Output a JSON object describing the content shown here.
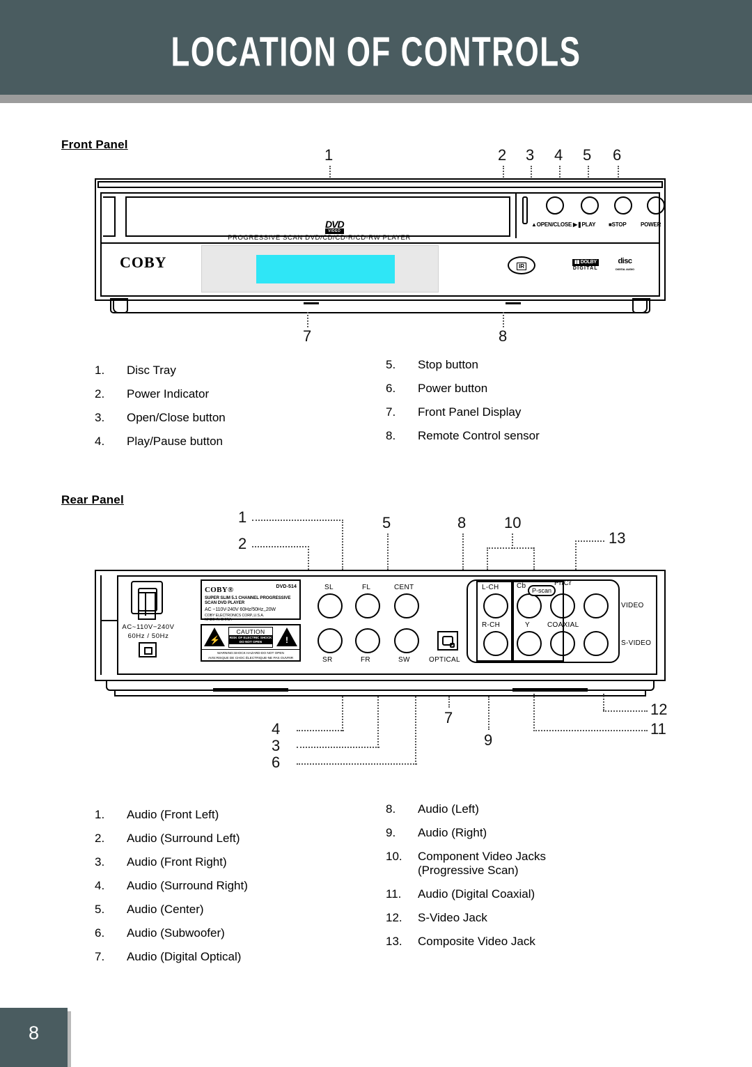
{
  "header": {
    "title": "LOCATION OF CONTROLS",
    "bar_color": "#4a5c60",
    "rule_color": "#9c9c9c"
  },
  "front_panel": {
    "heading": "Front Panel",
    "callouts_top": [
      "1",
      "2",
      "3",
      "4",
      "5",
      "6"
    ],
    "callouts_bottom": [
      "7",
      "8"
    ],
    "device": {
      "brand": "COBY",
      "dvd_logo": "DVD",
      "dvd_logo_sub": "VIDEO",
      "tray_text": "PROGRESSIVE SCAN DVD/CD/CD-R/CD-RW PLAYER",
      "buttons": [
        {
          "label": "▲OPEN/CLOSE"
        },
        {
          "label": "▶❚PLAY"
        },
        {
          "label": "■STOP"
        },
        {
          "label": "POWER"
        }
      ],
      "ir_label": "IR",
      "dolby_top": "▮▮ DOLBY",
      "dolby_bottom": "DIGITAL",
      "cd_logo_top": "disc",
      "cd_logo_bottom": "DIGITAL AUDIO",
      "display_color": "#2fe6f6"
    },
    "list_left": [
      {
        "num": "1.",
        "text": "Disc Tray"
      },
      {
        "num": "2.",
        "text": "Power Indicator"
      },
      {
        "num": "3.",
        "text": "Open/Close button"
      },
      {
        "num": "4.",
        "text": "Play/Pause button"
      }
    ],
    "list_right": [
      {
        "num": "5.",
        "text": "Stop button"
      },
      {
        "num": "6.",
        "text": "Power button"
      },
      {
        "num": "7.",
        "text": "Front Panel Display"
      },
      {
        "num": "8.",
        "text": "Remote Control sensor"
      }
    ]
  },
  "rear_panel": {
    "heading": "Rear Panel",
    "callouts_top": [
      "1",
      "2",
      "5",
      "8",
      "10",
      "13"
    ],
    "callouts_bottom": [
      "4",
      "3",
      "6",
      "7",
      "9",
      "12",
      "11"
    ],
    "device": {
      "ac_text_line1": "AC~110V−240V",
      "ac_text_line2": "60Hz / 50Hz",
      "label": {
        "brand": "COBY®",
        "model": "DVD-514",
        "line1": "SUPER SLIM 5.1 CHANNEL PROGRESSIVE",
        "line2": "SCAN DVD PLAYER",
        "line3": "AC ~110V-240V 60Hz/50Hz,,20W",
        "line4": "COBY ELECTRONICS CORP.,U.S.A.",
        "line5": "MADE IN CHINA"
      },
      "caution": {
        "title": "CAUTION",
        "sub1": "RISK OF ELECTRIC SHOCK",
        "sub2": "DO NOT OPEN",
        "warn1": "WARNING:SHOCK HAZARD-DO NOT OPEN",
        "warn2": "AVIS:RISQUE DE CHOC ÉLECTRIQUE-NE PAS OUVRIR"
      },
      "jack_labels": {
        "sl": "SL",
        "fl": "FL",
        "cent": "CENT",
        "sr": "SR",
        "fr": "FR",
        "sw": "SW",
        "optical": "OPTICAL",
        "l_ch": "L-CH",
        "r_ch": "R-CH",
        "cb": "Cb",
        "y": "Y",
        "pr_cr": "Pr/Cr",
        "p_scan": "P-scan",
        "coaxial": "COAXIAL",
        "video": "VIDEO",
        "s_video": "S-VIDEO"
      }
    },
    "list_left": [
      {
        "num": "1.",
        "text": "Audio (Front Left)"
      },
      {
        "num": "2.",
        "text": "Audio (Surround Left)"
      },
      {
        "num": "3.",
        "text": "Audio (Front Right)"
      },
      {
        "num": "4.",
        "text": "Audio (Surround Right)"
      },
      {
        "num": "5.",
        "text": "Audio (Center)"
      },
      {
        "num": "6.",
        "text": "Audio (Subwoofer)"
      },
      {
        "num": "7.",
        "text": "Audio (Digital Optical)"
      }
    ],
    "list_right": [
      {
        "num": "8.",
        "text": "Audio (Left)",
        "cont": ""
      },
      {
        "num": "9.",
        "text": "Audio (Right)",
        "cont": ""
      },
      {
        "num": "10.",
        "text": "Component Video Jacks",
        "cont": "(Progressive Scan)"
      },
      {
        "num": "11.",
        "text": "Audio (Digital Coaxial)",
        "cont": ""
      },
      {
        "num": "12.",
        "text": "S-Video Jack",
        "cont": ""
      },
      {
        "num": "13.",
        "text": "Composite Video Jack",
        "cont": ""
      }
    ]
  },
  "footer": {
    "page_number": "8"
  }
}
